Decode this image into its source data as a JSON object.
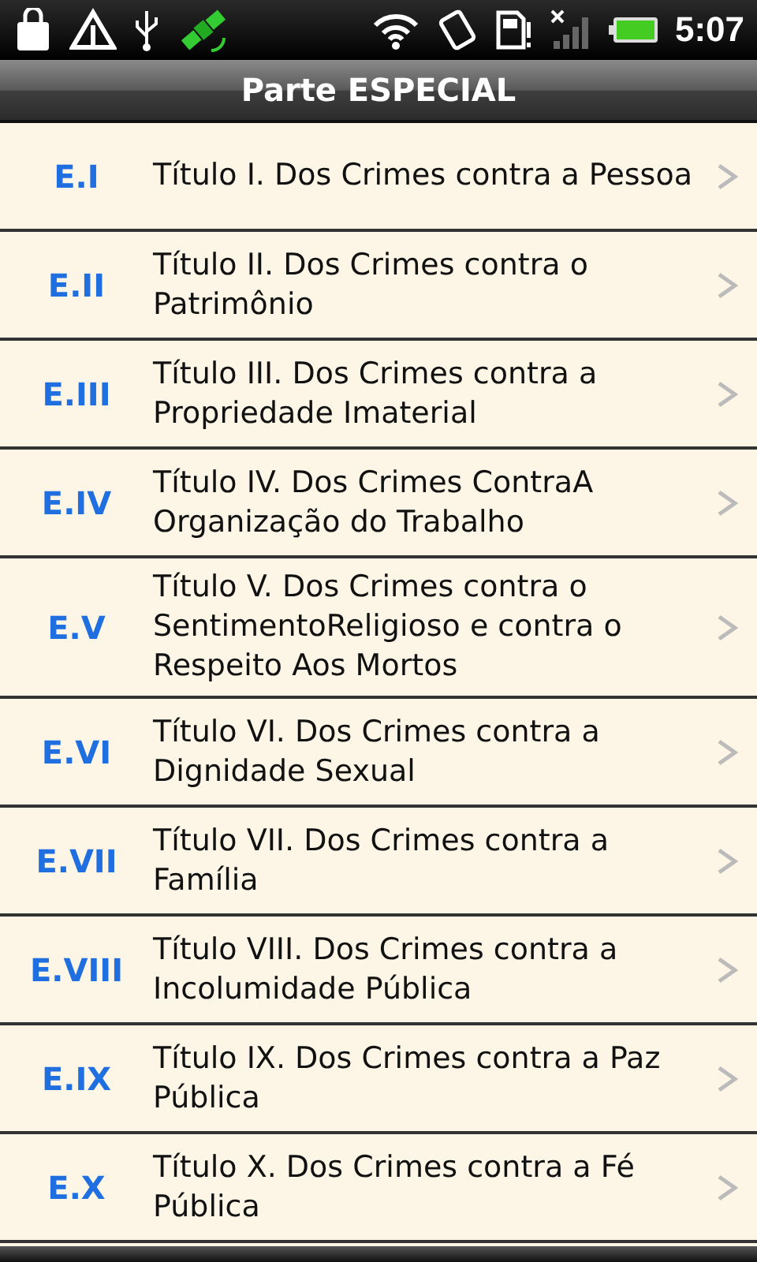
{
  "status_bar": {
    "time": "5:07"
  },
  "title_bar": {
    "title": "Parte ESPECIAL"
  },
  "items": [
    {
      "code": "E.I",
      "title": "Título I. Dos Crimes contra a Pessoa"
    },
    {
      "code": "E.II",
      "title": "Título II. Dos Crimes contra o Patrimônio"
    },
    {
      "code": "E.III",
      "title": "Título III. Dos Crimes contra a Propriedade Imaterial"
    },
    {
      "code": "E.IV",
      "title": "Título IV. Dos Crimes ContraA Organização do Trabalho"
    },
    {
      "code": "E.V",
      "title": "Título V. Dos Crimes contra o SentimentoReligioso e contra o Respeito Aos Mortos"
    },
    {
      "code": "E.VI",
      "title": "Título VI. Dos Crimes contra a Dignidade Sexual"
    },
    {
      "code": "E.VII",
      "title": "Título VII. Dos Crimes contra a Família"
    },
    {
      "code": "E.VIII",
      "title": "Título VIII. Dos Crimes contra a Incolumidade Pública"
    },
    {
      "code": "E.IX",
      "title": "Título IX. Dos Crimes contra a Paz Pública"
    },
    {
      "code": "E.X",
      "title": "Título X. Dos Crimes contra a Fé Pública"
    }
  ]
}
